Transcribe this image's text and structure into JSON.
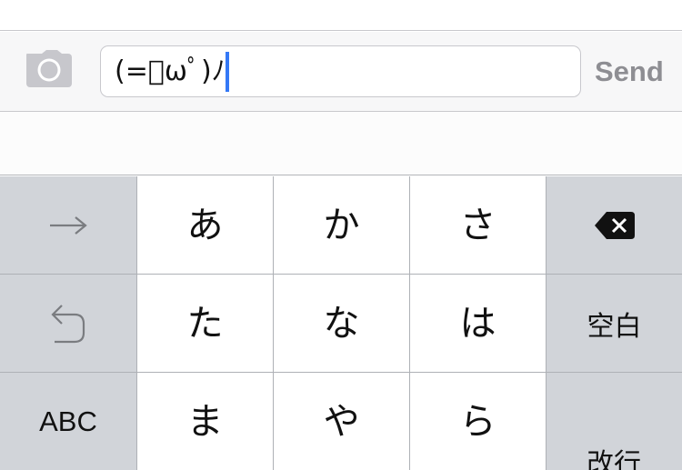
{
  "composer": {
    "text_value": "(=ﾟωﾟ)ﾉ",
    "send_label": "Send",
    "camera_icon": "camera-icon"
  },
  "keyboard": {
    "row1": {
      "arrow_icon": "arrow-right-icon",
      "keys": [
        "あ",
        "か",
        "さ"
      ],
      "delete_icon": "delete-backspace-icon"
    },
    "row2": {
      "undo_icon": "undo-icon",
      "keys": [
        "た",
        "な",
        "は"
      ],
      "space_label": "空白"
    },
    "row3": {
      "abc_label": "ABC",
      "keys": [
        "ま",
        "や",
        "ら"
      ],
      "enter_label": "改行"
    }
  },
  "colors": {
    "caret": "#3478f6",
    "send_disabled": "#8e8e93",
    "key_gray": "#d1d4d9",
    "key_white": "#ffffff",
    "key_separator": "#aeb1b6"
  }
}
